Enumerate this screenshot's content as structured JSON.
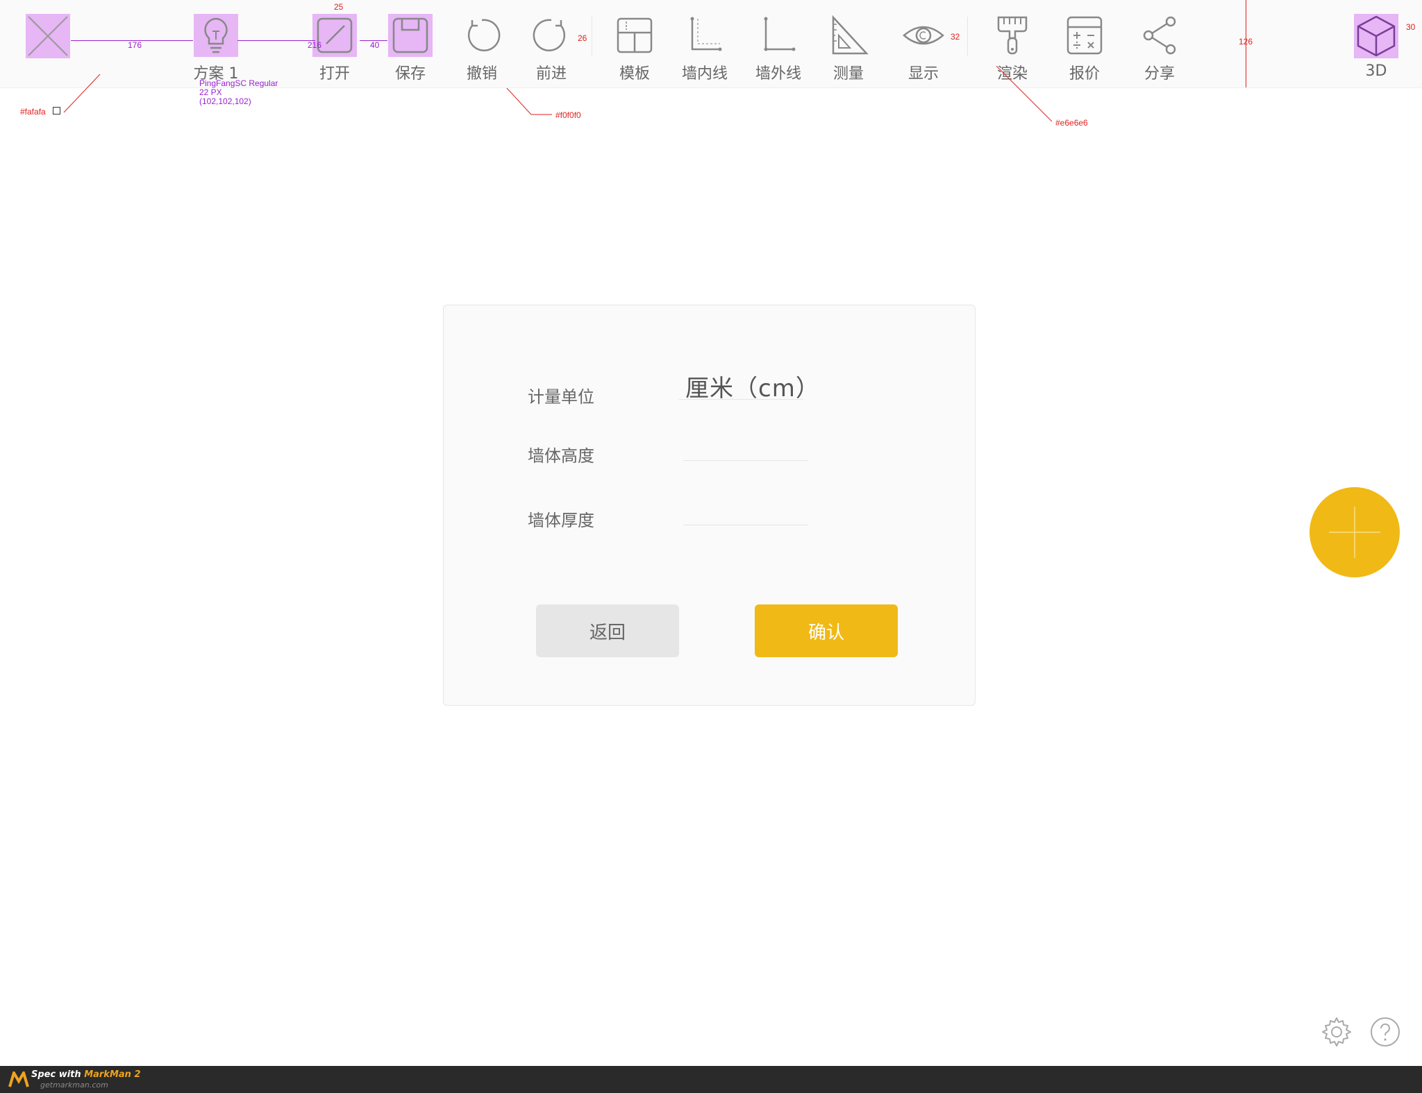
{
  "toolbar": {
    "background": "#fafafa",
    "items": [
      {
        "id": "logo",
        "label": "",
        "icon": "x-placeholder-icon"
      },
      {
        "id": "plan",
        "label": "方案 1",
        "icon": "lightbulb-icon"
      },
      {
        "id": "open",
        "label": "打开",
        "icon": "open-icon"
      },
      {
        "id": "save",
        "label": "保存",
        "icon": "save-icon"
      },
      {
        "id": "undo",
        "label": "撤销",
        "icon": "undo-icon"
      },
      {
        "id": "redo",
        "label": "前进",
        "icon": "redo-icon"
      },
      {
        "id": "template",
        "label": "模板",
        "icon": "template-icon"
      },
      {
        "id": "inner-wall",
        "label": "墙内线",
        "icon": "inner-wall-line-icon"
      },
      {
        "id": "outer-wall",
        "label": "墙外线",
        "icon": "outer-wall-line-icon"
      },
      {
        "id": "measure",
        "label": "测量",
        "icon": "triangle-ruler-icon"
      },
      {
        "id": "display",
        "label": "显示",
        "icon": "eye-icon"
      },
      {
        "id": "render",
        "label": "渲染",
        "icon": "paint-brush-icon"
      },
      {
        "id": "quote",
        "label": "报价",
        "icon": "calculator-icon"
      },
      {
        "id": "share",
        "label": "分享",
        "icon": "share-icon"
      },
      {
        "id": "3d",
        "label": "3D",
        "icon": "cube-icon"
      }
    ]
  },
  "spec": {
    "dim_176": "176",
    "dim_216": "216",
    "dim_40": "40",
    "dim_25": "25",
    "dim_26": "26",
    "dim_32": "32",
    "dim_126": "126",
    "dim_30": "30",
    "color_fafafa": "#fafafa",
    "color_f0f0f0": "#f0f0f0",
    "color_e6e6e6": "#e6e6e6",
    "font_name": "PingFangSC Regular",
    "font_size": "22 PX",
    "font_color": "(102,102,102)"
  },
  "dialog": {
    "unit_label": "计量单位",
    "unit_value": "厘米（cm）",
    "wall_height_label": "墙体高度",
    "wall_height_value": "",
    "wall_thickness_label": "墙体厚度",
    "wall_thickness_value": "",
    "back_label": "返回",
    "confirm_label": "确认"
  },
  "colors": {
    "accent": "#f0b916",
    "button_gray": "#e6e6e6",
    "text": "#666666"
  },
  "footer": {
    "brand_prefix": "Spec with ",
    "brand": "MarkMan 2",
    "url": "getmarkman.com"
  }
}
